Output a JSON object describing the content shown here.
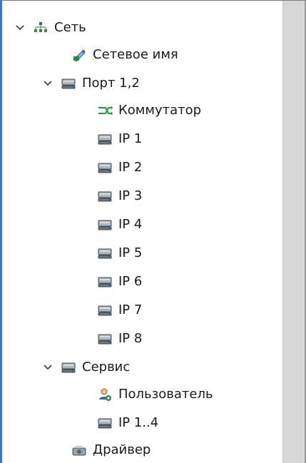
{
  "tree": {
    "root": {
      "label": "Сеть",
      "icon": "network-icon"
    },
    "network_name": {
      "label": "Сетевое имя",
      "icon": "network-name-icon"
    },
    "port": {
      "label": "Порт 1,2",
      "icon": "server-icon"
    },
    "switch": {
      "label": "Коммутатор",
      "icon": "switch-icon"
    },
    "ip_items": [
      {
        "label": "IP 1"
      },
      {
        "label": "IP 2"
      },
      {
        "label": "IP 3"
      },
      {
        "label": "IP 4"
      },
      {
        "label": "IP 5"
      },
      {
        "label": "IP 6"
      },
      {
        "label": "IP 7"
      },
      {
        "label": "IP 8"
      }
    ],
    "service": {
      "label": "Сервис",
      "icon": "server-icon"
    },
    "user": {
      "label": "Пользователь",
      "icon": "user-icon"
    },
    "ip_range": {
      "label": "IP 1..4",
      "icon": "server-icon"
    },
    "driver": {
      "label": "Драйвер",
      "icon": "driver-icon"
    }
  },
  "colors": {
    "accent": "#3b78c3",
    "chevron": "#444444",
    "server_body": "#9aa3aa",
    "server_dark": "#3f4a52",
    "network_green": "#2e8b3b",
    "network_blue": "#2a66b5",
    "switch_green": "#1f9d3a",
    "scrollbar": "#d7d7d7"
  }
}
